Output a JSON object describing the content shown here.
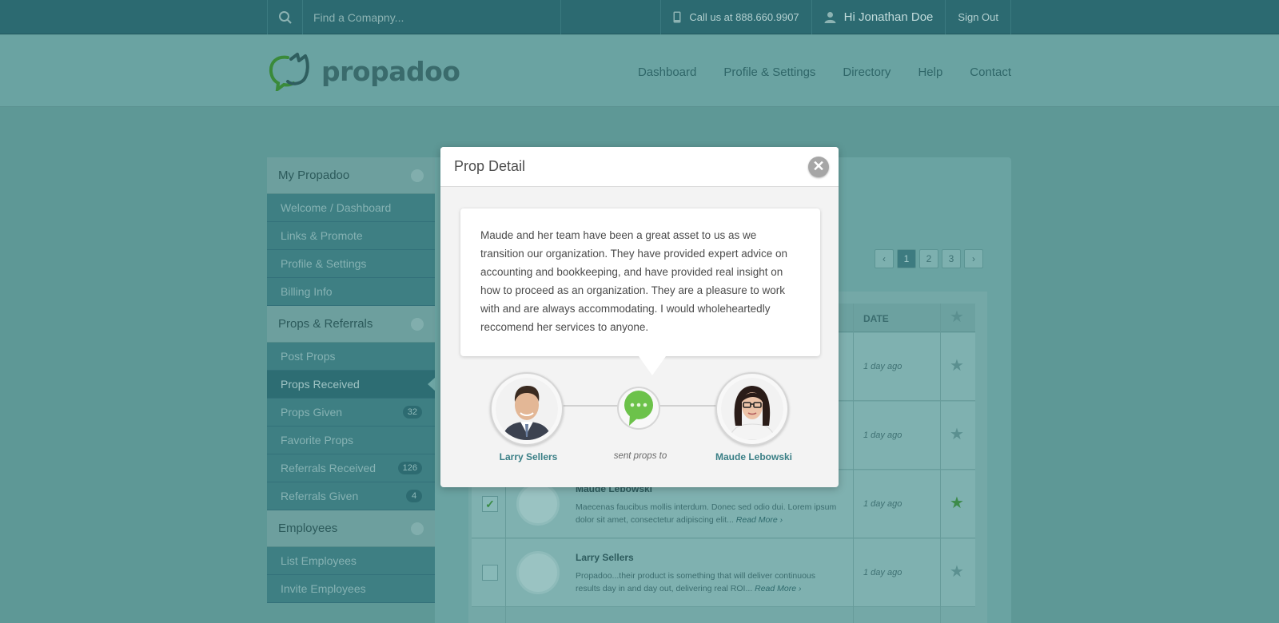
{
  "topbar": {
    "search_placeholder": "Find a Comapny...",
    "phone_text": "Call us at 888.660.9907",
    "greeting": "Hi Jonathan Doe",
    "signout_label": "Sign Out"
  },
  "brand": {
    "name": "propadoo"
  },
  "nav": {
    "items": [
      "Dashboard",
      "Profile & Settings",
      "Directory",
      "Help",
      "Contact"
    ]
  },
  "sidebar": {
    "sections": [
      {
        "title": "My Propadoo",
        "items": [
          {
            "label": "Welcome / Dashboard",
            "badge": ""
          },
          {
            "label": "Links & Promote",
            "badge": ""
          },
          {
            "label": "Profile & Settings",
            "badge": ""
          },
          {
            "label": "Billing Info",
            "badge": ""
          }
        ]
      },
      {
        "title": "Props & Referrals",
        "items": [
          {
            "label": "Post Props",
            "badge": ""
          },
          {
            "label": "Props Received",
            "badge": ""
          },
          {
            "label": "Props Given",
            "badge": "32"
          },
          {
            "label": "Favorite Props",
            "badge": ""
          },
          {
            "label": "Referrals Received",
            "badge": "126"
          },
          {
            "label": "Referrals Given",
            "badge": "4"
          }
        ]
      },
      {
        "title": "Employees",
        "items": [
          {
            "label": "List Employees",
            "badge": ""
          },
          {
            "label": "Invite Employees",
            "badge": ""
          }
        ]
      }
    ]
  },
  "pager": {
    "prev": "‹",
    "pages": [
      "1",
      "2",
      "3"
    ],
    "next": "›"
  },
  "table": {
    "date_header": "DATE",
    "rows": [
      {
        "name": "",
        "text": "",
        "more": "",
        "date": "1 day ago",
        "starred": false,
        "checked": false
      },
      {
        "name": "",
        "text": "",
        "more": "",
        "date": "1 day ago",
        "starred": false,
        "checked": false
      },
      {
        "name": "Maude Lebowski",
        "text": "Maecenas faucibus mollis interdum. Donec sed odio dui. Lorem ipsum dolor sit amet, consectetur adipiscing elit...",
        "more": "Read More ›",
        "date": "1 day ago",
        "starred": true,
        "checked": true
      },
      {
        "name": "Larry Sellers",
        "text": "Propadoo...their product is something that will deliver continuous results day in and day out, delivering real ROI...",
        "more": "Read More ›",
        "date": "1 day ago",
        "starred": false,
        "checked": false
      }
    ]
  },
  "modal": {
    "title": "Prop Detail",
    "close_label": "✕",
    "quote": "Maude and her team have been a great asset to us as we transition our organization. They have provided expert advice on accounting and bookkeeping, and have provided real insight on how to proceed as an organization. They are a pleasure to work with and are always accommodating. I would wholeheartedly reccomend her services to anyone.",
    "sender": "Larry Sellers",
    "action": "sent props to",
    "recipient": "Maude Lebowski"
  },
  "colors": {
    "accent": "#3a7f86",
    "topbar": "#2c6a71",
    "bubble_green": "#6cc24a"
  }
}
